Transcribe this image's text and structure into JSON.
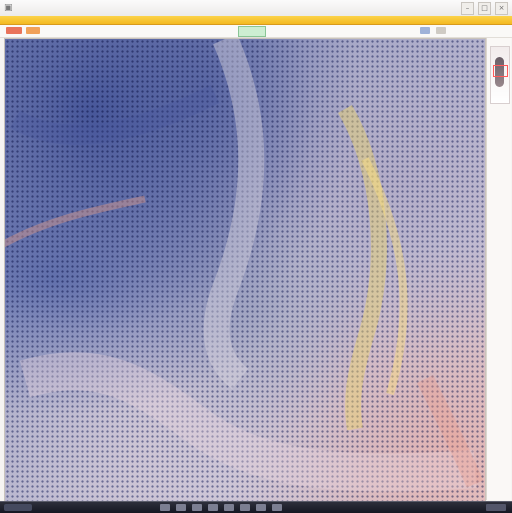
{
  "window": {
    "title": "",
    "controls": [
      "minimize",
      "maximize",
      "close"
    ],
    "icons": [
      "app-icon",
      "minimize-icon",
      "maximize-icon",
      "close-icon"
    ]
  },
  "toolbar": {
    "zoom": "",
    "accent_colors": {
      "title_bar": "#f4b922",
      "tool_red": "#e9735a",
      "tool_orange": "#f1a15a",
      "zoom_field": "#cdeed2"
    }
  },
  "viewer": {
    "content": "histology-slide",
    "stain_colors": {
      "nuclei": "#3c4d94",
      "stroma": "#b0a8c4",
      "highlight": "#f2d25b",
      "eosin": "#e8a096"
    }
  },
  "side_panel": {
    "thumbnail": "slide-overview",
    "roi_color": "#ff5a5a"
  },
  "taskbar": {
    "items": 8
  }
}
